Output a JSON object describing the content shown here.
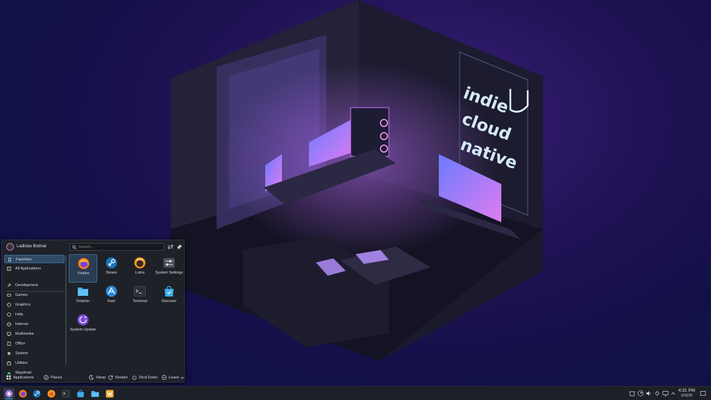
{
  "wallpaper": {
    "neon_sign": [
      "indie",
      "cloud",
      "native"
    ]
  },
  "launcher": {
    "user_name": "Ladislav Bodnar",
    "search": {
      "placeholder": "Search...",
      "value": ""
    },
    "categories": [
      {
        "label": "Favorites",
        "icon": "bookmark-icon",
        "selected": true
      },
      {
        "label": "All Applications",
        "icon": "grid-icon",
        "selected": false
      },
      {
        "label": "Development",
        "icon": "wrench-icon",
        "selected": false
      },
      {
        "label": "Games",
        "icon": "gamepad-icon",
        "selected": false
      },
      {
        "label": "Graphics",
        "icon": "palette-icon",
        "selected": false
      },
      {
        "label": "Help",
        "icon": "help-icon",
        "selected": false
      },
      {
        "label": "Internet",
        "icon": "globe-icon",
        "selected": false
      },
      {
        "label": "Multimedia",
        "icon": "monitor-icon",
        "selected": false
      },
      {
        "label": "Office",
        "icon": "document-icon",
        "selected": false
      },
      {
        "label": "System",
        "icon": "gear-icon",
        "selected": false
      },
      {
        "label": "Utilities",
        "icon": "toolbox-icon",
        "selected": false
      },
      {
        "label": "Waydroid",
        "icon": "android-icon",
        "selected": false
      }
    ],
    "apps": [
      {
        "label": "Firefox",
        "icon": "firefox-icon",
        "selected": true
      },
      {
        "label": "Steam",
        "icon": "steam-icon",
        "selected": false
      },
      {
        "label": "Lutris",
        "icon": "lutris-icon",
        "selected": false
      },
      {
        "label": "System Settings",
        "icon": "settings-icon",
        "selected": false
      },
      {
        "label": "Dolphin",
        "icon": "folder-icon",
        "selected": false
      },
      {
        "label": "Kate",
        "icon": "kate-icon",
        "selected": false
      },
      {
        "label": "Terminal",
        "icon": "terminal-icon",
        "selected": false
      },
      {
        "label": "Discover",
        "icon": "store-icon",
        "selected": false
      },
      {
        "label": "System Update",
        "icon": "update-icon",
        "selected": false
      }
    ],
    "footer": {
      "applications": "Applications",
      "places": "Places",
      "sleep": "Sleep",
      "restart": "Restart",
      "shutdown": "Shut Down",
      "leave": "Leave"
    }
  },
  "taskbar": {
    "items": [
      {
        "name": "application-launcher",
        "icon": "plasma-icon",
        "active": true
      },
      {
        "name": "firefox",
        "icon": "firefox-icon",
        "active": false
      },
      {
        "name": "steam",
        "icon": "steam-icon",
        "active": false
      },
      {
        "name": "firefox-window",
        "icon": "firefox-icon",
        "active": false
      },
      {
        "name": "terminal",
        "icon": "terminal-icon",
        "active": false
      },
      {
        "name": "discover",
        "icon": "store-icon",
        "active": false
      },
      {
        "name": "dolphin",
        "icon": "folder-icon",
        "active": false
      },
      {
        "name": "welcome",
        "icon": "welcome-icon",
        "active": false
      }
    ],
    "clock": {
      "time": "4:31 PM",
      "date": "3/29/25"
    }
  },
  "colors": {
    "accent": "#3daee9",
    "panel": "#1d2027",
    "launcher_bg": "#1e2128"
  }
}
